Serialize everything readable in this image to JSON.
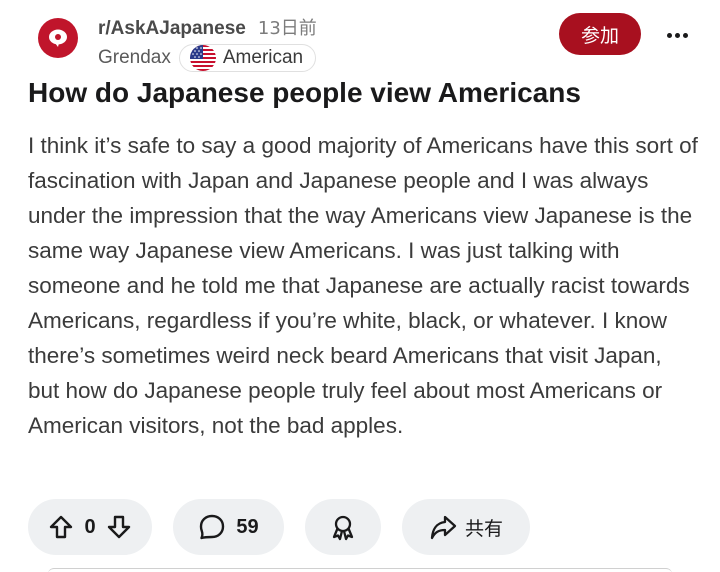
{
  "post": {
    "subreddit": "r/AskAJapanese",
    "time_ago": "13日前",
    "author": "Grendax",
    "flair": "American",
    "join_label": "参加",
    "title": "How do Japanese people view Americans",
    "body": "I think it’s safe to say a good majority of Americans have this sort of fascination with Japan and Japanese people and I was always under the impression that the way Americans view Japanese is the same way Japanese view Americans. I was just talking with someone and he told me that Japanese are actually racist towards Americans, regardless if you’re white, black, or whatever. I know there’s sometimes weird neck beard Americans that visit Japan, but how do Japanese people truly feel about most Americans or American visitors, not the bad apples."
  },
  "actions": {
    "vote_count": "0",
    "comment_count": "59",
    "share_label": "共有"
  },
  "icons": {
    "avatar": "subreddit-avatar-icon",
    "upvote": "arrow-up-icon",
    "downvote": "arrow-down-icon",
    "comment": "comment-bubble-icon",
    "award": "award-icon",
    "share": "share-arrow-icon",
    "more": "more-dots-icon",
    "flag": "us-flag-icon"
  },
  "colors": {
    "brand": "#a8101f",
    "pill_bg": "#eef0f2"
  }
}
